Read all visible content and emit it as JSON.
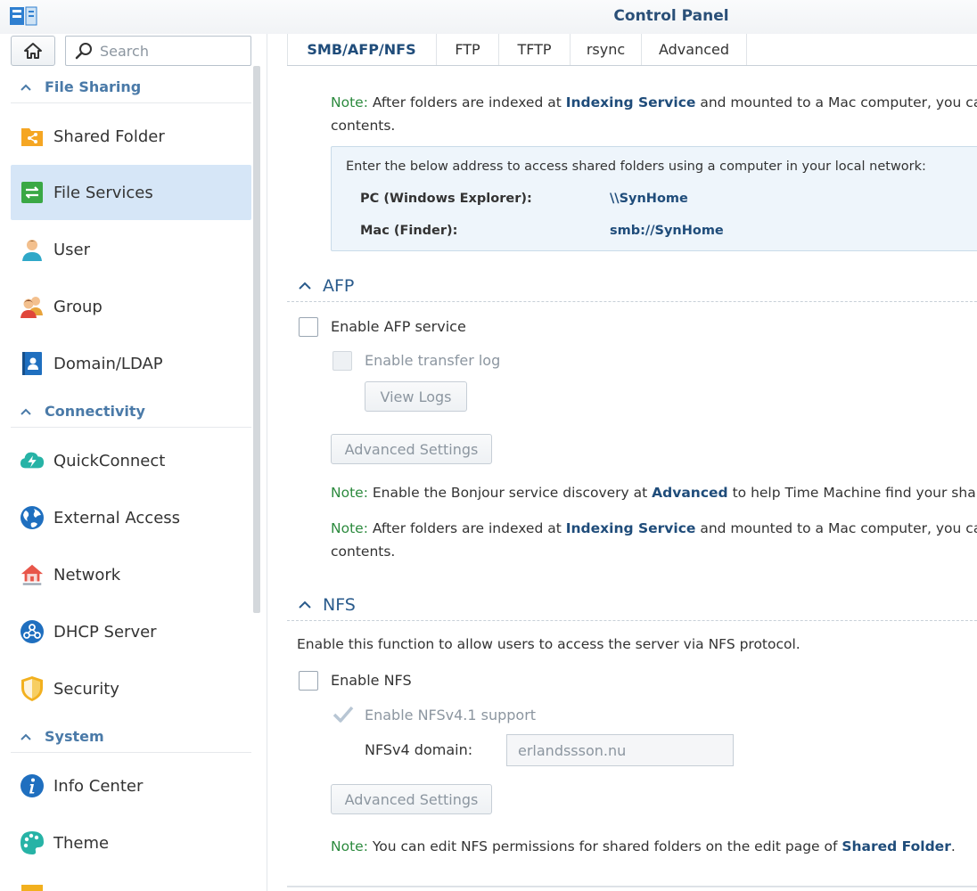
{
  "window": {
    "title": "Control Panel",
    "app_icon": "control-panel-icon"
  },
  "sidebar": {
    "search_placeholder": "Search",
    "groups": [
      {
        "label": "File Sharing"
      },
      {
        "label": "Connectivity"
      },
      {
        "label": "System"
      }
    ],
    "items": [
      {
        "label": "Shared Folder",
        "icon": "shared-folder-icon",
        "active": false
      },
      {
        "label": "File Services",
        "icon": "file-services-icon",
        "active": true
      },
      {
        "label": "User",
        "icon": "user-icon",
        "active": false
      },
      {
        "label": "Group",
        "icon": "group-icon",
        "active": false
      },
      {
        "label": "Domain/LDAP",
        "icon": "domain-ldap-icon",
        "active": false
      },
      {
        "label": "QuickConnect",
        "icon": "quickconnect-icon",
        "active": false
      },
      {
        "label": "External Access",
        "icon": "external-access-icon",
        "active": false
      },
      {
        "label": "Network",
        "icon": "network-icon",
        "active": false
      },
      {
        "label": "DHCP Server",
        "icon": "dhcp-server-icon",
        "active": false
      },
      {
        "label": "Security",
        "icon": "security-icon",
        "active": false
      },
      {
        "label": "Info Center",
        "icon": "info-center-icon",
        "active": false
      },
      {
        "label": "Theme",
        "icon": "theme-icon",
        "active": false
      }
    ]
  },
  "tabs": [
    {
      "label": "SMB/AFP/NFS",
      "active": true
    },
    {
      "label": "FTP",
      "active": false
    },
    {
      "label": "TFTP",
      "active": false
    },
    {
      "label": "rsync",
      "active": false
    },
    {
      "label": "Advanced",
      "active": false
    }
  ],
  "smb": {
    "note_label": "Note:",
    "note_part1": " After folders are indexed at ",
    "note_link": "Indexing Service",
    "note_part2": " and mounted to a Mac computer, you ca",
    "note_line2": "contents.",
    "info_header": "Enter the below address to access shared folders using a computer in your local network:",
    "pc_label": "PC (Windows Explorer):",
    "pc_value": "\\\\SynHome",
    "mac_label": "Mac (Finder):",
    "mac_value": "smb://SynHome"
  },
  "afp": {
    "title": "AFP",
    "enable_label": "Enable AFP service",
    "enabled": false,
    "transfer_log_label": "Enable transfer log",
    "view_logs_label": "View Logs",
    "advanced_settings_label": "Advanced Settings",
    "note1_label": "Note:",
    "note1_part1": " Enable the Bonjour service discovery at ",
    "note1_link": "Advanced",
    "note1_part2": " to help Time Machine find your shar",
    "note2_label": "Note:",
    "note2_part1": " After folders are indexed at ",
    "note2_link": "Indexing Service",
    "note2_part2": " and mounted to a Mac computer, you ca",
    "note2_line2": "contents."
  },
  "nfs": {
    "title": "NFS",
    "description": "Enable this function to allow users to access the server via NFS protocol.",
    "enable_label": "Enable NFS",
    "enabled": false,
    "nfsv41_label": "Enable NFSv4.1 support",
    "nfsv41_checked": true,
    "domain_label": "NFSv4 domain:",
    "domain_value": "erlandssson.nu",
    "advanced_settings_label": "Advanced Settings",
    "note_label": "Note:",
    "note_part1": " You can edit NFS permissions for shared folders on the edit page of ",
    "note_link": "Shared Folder",
    "note_part2": "."
  }
}
